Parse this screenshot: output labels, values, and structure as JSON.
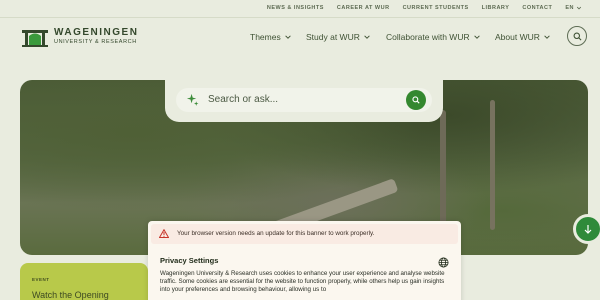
{
  "topbar": {
    "links": [
      "NEWS & INSIGHTS",
      "CAREER AT WUR",
      "CURRENT STUDENTS",
      "LIBRARY",
      "CONTACT"
    ],
    "language": "EN"
  },
  "logo": {
    "line1": "WAGENINGEN",
    "line2": "UNIVERSITY & RESEARCH"
  },
  "nav": {
    "items": [
      {
        "label": "Themes"
      },
      {
        "label": "Study at WUR"
      },
      {
        "label": "Collaborate with WUR"
      },
      {
        "label": "About WUR"
      }
    ]
  },
  "search": {
    "placeholder": "Search or ask..."
  },
  "event": {
    "tag": "EVENT",
    "title": "Watch the Opening"
  },
  "privacy": {
    "warning": "Your browser version needs an update for this banner to work properly.",
    "title": "Privacy Settings",
    "text": "Wageningen University & Research uses cookies to enhance your user experience and analyse website traffic. Some cookies are essential for the website to function properly, while others help us gain insights into your preferences and browsing behaviour, allowing us to"
  },
  "colors": {
    "accent": "#34882f",
    "event_card": "#b8c94a",
    "background": "#e9ecdf",
    "warning_bg": "#f9ebe3"
  },
  "icons": {
    "chevron": "chevron-down-icon",
    "search": "search-icon",
    "sparkle": "sparkle-icon",
    "arrow_down": "arrow-down-icon",
    "warning": "warning-triangle-icon",
    "globe": "globe-icon"
  }
}
